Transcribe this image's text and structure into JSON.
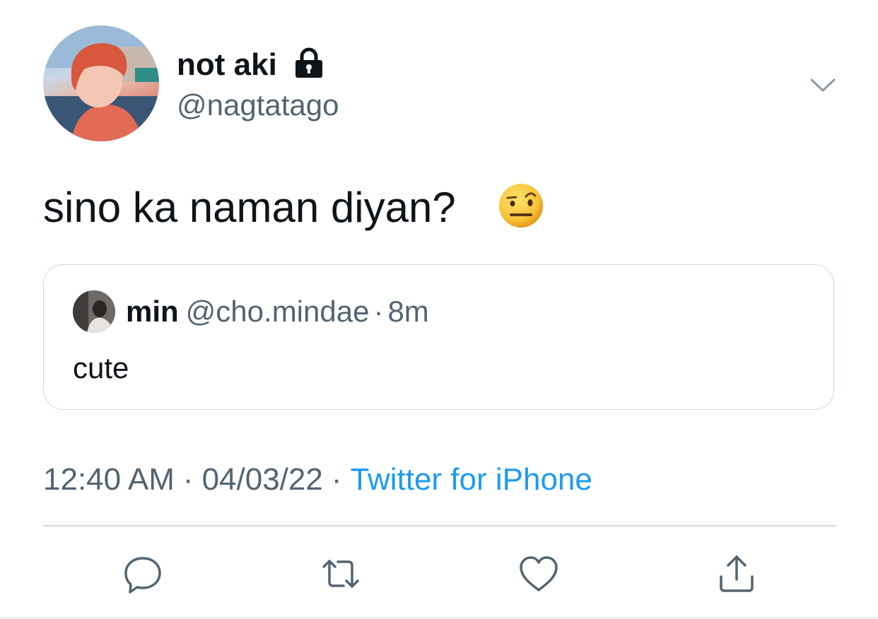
{
  "author": {
    "display_name": "not aki",
    "handle": "@nagtatago",
    "protected_icon": "lock-icon",
    "avatar_icon": "profile-photo"
  },
  "tweet": {
    "text": "sino ka naman diyan?",
    "emoji": "face-with-raised-eyebrow"
  },
  "quoted_tweet": {
    "display_name": "min",
    "handle": "@cho.mindae",
    "separator": "·",
    "time": "8m",
    "text": "cute"
  },
  "meta": {
    "time": "12:40 AM",
    "separator": "·",
    "date": "04/03/22",
    "source": "Twitter for iPhone"
  },
  "actions": {
    "reply_icon": "reply-icon",
    "retweet_icon": "retweet-icon",
    "like_icon": "heart-icon",
    "share_icon": "share-icon"
  },
  "colors": {
    "text": "#0f1419",
    "secondary": "#536471",
    "link": "#1d9bf0",
    "border": "#cfd9de"
  }
}
